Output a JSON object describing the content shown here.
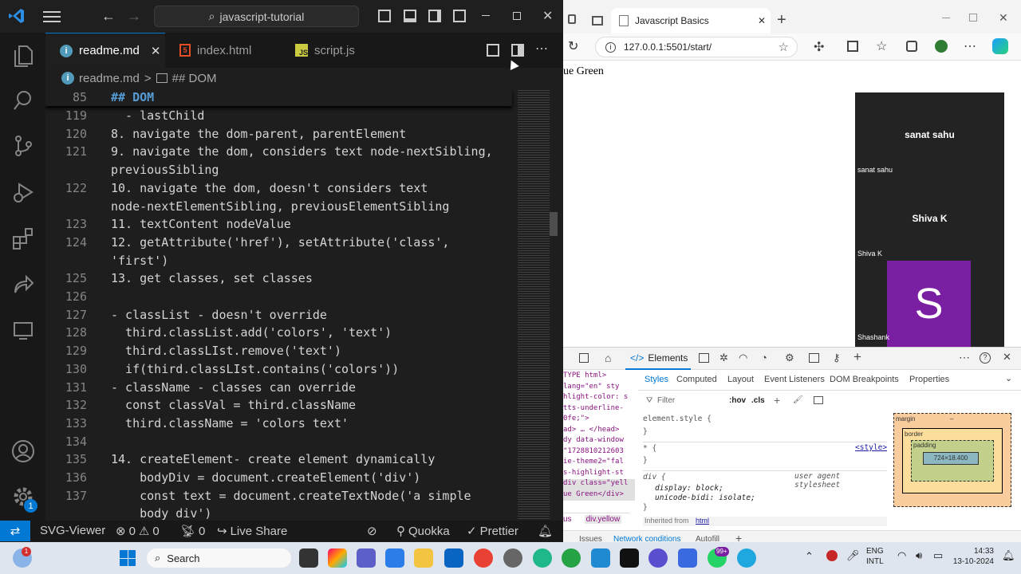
{
  "vscode": {
    "search_text": "javascript-tutorial",
    "tabs": [
      {
        "label": "readme.md",
        "icon": "info-icon"
      },
      {
        "label": "index.html",
        "icon": "html5-icon"
      },
      {
        "label": "script.js",
        "icon": "js-icon"
      }
    ],
    "breadcrumb": {
      "file": "readme.md",
      "separator": ">",
      "section": "## DOM"
    },
    "sticky_line": {
      "num": "85",
      "text": "## DOM"
    },
    "lines": [
      {
        "num": "119",
        "text": "  - lastChild"
      },
      {
        "num": "120",
        "text": "8. navigate the dom-parent, parentElement"
      },
      {
        "num": "121",
        "text": "9. navigate the dom, considers text node-nextSibling,"
      },
      {
        "num": "",
        "text": "previousSibling"
      },
      {
        "num": "122",
        "text": "10. navigate the dom, doesn't considers text"
      },
      {
        "num": "",
        "text": "node-nextElementSibling, previousElementSibling"
      },
      {
        "num": "123",
        "text": "11. textContent nodeValue"
      },
      {
        "num": "124",
        "text": "12. getAttribute('href'), setAttribute('class',"
      },
      {
        "num": "",
        "text": "'first')"
      },
      {
        "num": "125",
        "text": "13. get classes, set classes"
      },
      {
        "num": "126",
        "text": ""
      },
      {
        "num": "127",
        "text": "- classList - doesn't override"
      },
      {
        "num": "128",
        "text": "  third.classList.add('colors', 'text')"
      },
      {
        "num": "129",
        "text": "  third.classLIst.remove('text')"
      },
      {
        "num": "130",
        "text": "  if(third.classLIst.contains('colors'))"
      },
      {
        "num": "131",
        "text": "- className - classes can override"
      },
      {
        "num": "132",
        "text": "  const classVal = third.className"
      },
      {
        "num": "133",
        "text": "  third.className = 'colors text'"
      },
      {
        "num": "134",
        "text": ""
      },
      {
        "num": "135",
        "text": "14. createElement- create element dynamically"
      },
      {
        "num": "136",
        "text": "    bodyDiv = document.createElement('div')"
      },
      {
        "num": "137",
        "text": "    const text = document.createTextNode('a simple"
      },
      {
        "num": "",
        "text": "    body div')"
      }
    ],
    "account_badge": "1",
    "status": {
      "remote": "SVG-Viewer",
      "errors": "0",
      "warnings": "0",
      "ports": "0",
      "liveshare": "Live Share",
      "quokka": "Quokka",
      "prettier": "Prettier"
    }
  },
  "browser": {
    "tab_title": "Javascript Basics",
    "url": "127.0.0.1:5501/start/",
    "page_text": "ue Green",
    "cards": [
      {
        "name": "sanat sahu",
        "caption": "sanat sahu"
      },
      {
        "name": "Shiva K",
        "caption": "Shiva K"
      }
    ],
    "avatar": {
      "letter": "S",
      "caption": "Shashank",
      "color": "#7b1fa2"
    },
    "devtools": {
      "main_tab": "Elements",
      "subtabs": [
        "Styles",
        "Computed",
        "Layout",
        "Event Listeners",
        "DOM Breakpoints",
        "Properties"
      ],
      "filter_placeholder": "Filter",
      "hov": ":hov",
      "cls": ".cls",
      "dom_lines": [
        "TYPE html>",
        "lang=\"en\" sty",
        "hlight-color: s",
        "tts-underline-",
        "0fe;\">",
        "ad> … </head>",
        "dy data-window",
        "\"1728810212603",
        "ie-theme2=\"fal",
        "s-highlight-st",
        "div class=\"yell",
        "ue Green</div>"
      ],
      "styles": [
        "element.style {",
        "}",
        "* {",
        "}",
        "div {",
        "display: block;",
        "unicode-bidi: isolate;",
        "}"
      ],
      "style_source": "<style>",
      "ua_label": "user agent stylesheet",
      "inherited": "Inherited from",
      "inherited_tag": "html",
      "crumbs": [
        "us",
        "div.yellow"
      ],
      "drawer_tabs": [
        "Issues",
        "Network conditions",
        "Autofill"
      ],
      "box": {
        "margin": "margin",
        "border": "border",
        "padding": "padding",
        "content": "724×18.400",
        "dash": "–"
      }
    }
  },
  "taskbar": {
    "search": "Search",
    "lang1": "ENG",
    "lang2": "INTL",
    "time": "14:33",
    "date": "13-10-2024",
    "whatsapp_badge": "99+",
    "weather_badge": "1"
  }
}
